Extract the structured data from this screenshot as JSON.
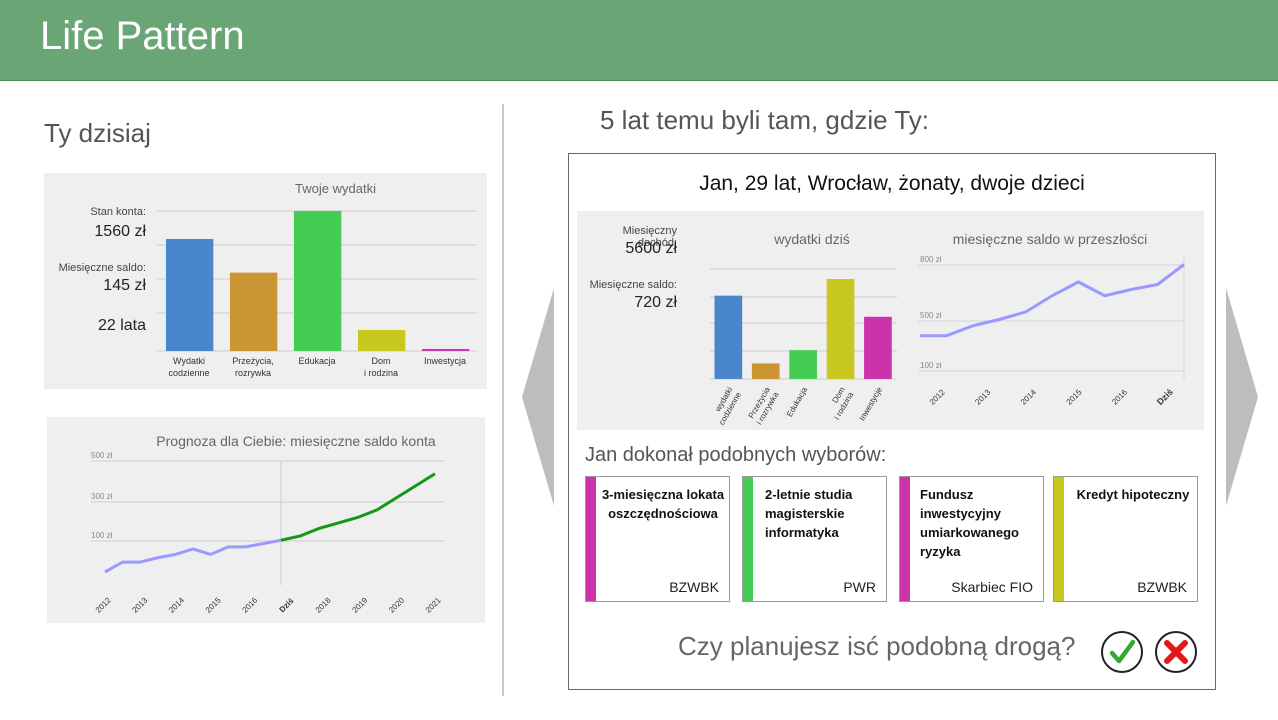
{
  "header": {
    "title": "Life Pattern"
  },
  "left": {
    "title": "Ty dzisiaj",
    "expenses_chart": {
      "title": "Twoje wydatki"
    },
    "stats": {
      "balance_label": "Stan konta:",
      "balance_value": "1560 zł",
      "saldo_label": "Miesięczne saldo:",
      "saldo_value": "145 zł",
      "age": "22 lata"
    },
    "forecast_chart": {
      "title": "Prognoza dla Ciebie: miesięczne saldo konta"
    }
  },
  "right": {
    "title": "5 lat temu byli tam, gdzie Ty:",
    "person": "Jan, 29 lat, Wrocław, żonaty, dwoje dzieci",
    "stats": {
      "income_label": "Miesięczny dochód:",
      "income_value": "5600 zł",
      "saldo_label": "Miesięczne saldo:",
      "saldo_value": "720 zł"
    },
    "expenses_chart": {
      "title": "wydatki dziś"
    },
    "saldo_chart": {
      "title": "miesięczne saldo w przeszłości"
    },
    "choices_title": "Jan dokonał podobnych wyborów:",
    "choices": [
      {
        "title": "3-miesięczna lokata oszczędnościowa",
        "org": "BZWBK",
        "color": "#cc33aa"
      },
      {
        "title": "2-letnie studia magisterskie informatyka",
        "org": "PWR",
        "color": "#44cc55"
      },
      {
        "title": "Fundusz inwestycyjny umiarkowanego ryzyka",
        "org": "Skarbiec FIO",
        "color": "#cc33aa"
      },
      {
        "title": "Kredyt hipoteczny",
        "org": "BZWBK",
        "color": "#c8c820"
      }
    ],
    "question": "Czy planujesz isć podobną drogą?",
    "icons": {
      "accept": "check-icon",
      "reject": "cross-icon"
    }
  },
  "colors": {
    "header": "#6aa675",
    "accept": "#33a833",
    "reject": "#e01818"
  },
  "chart_data": [
    {
      "type": "bar",
      "title": "Twoje wydatki",
      "categories": [
        "Wydatki\ncodzienne",
        "Przeżycia,\nrozrywka",
        "Edukacja",
        "Dom\ni rodzina",
        "Inwestycja"
      ],
      "values": [
        80,
        56,
        100,
        15,
        1
      ],
      "colors": [
        "#4a86cc",
        "#cc9533",
        "#44cc55",
        "#c8c820",
        "#cc33aa"
      ],
      "grid": true
    },
    {
      "type": "line",
      "title": "Prognoza dla Ciebie: miesięczne saldo konta",
      "x": [
        "2012",
        "2013",
        "2014",
        "2015",
        "2016",
        "Dziś",
        "2018",
        "2019",
        "2020",
        "2021"
      ],
      "y_ticks": [
        "500 zł",
        "300 zł",
        "100 zł"
      ],
      "ylim": [
        -50,
        500
      ],
      "series": [
        {
          "values": [
            10,
            55,
            55,
            75,
            90,
            115,
            90,
            125,
            125,
            140,
            155
          ]
        },
        {
          "values": [
            155,
            175,
            210,
            235,
            260,
            295,
            350,
            405,
            460
          ]
        }
      ],
      "colors": [
        "#9999ff",
        "#119911"
      ]
    },
    {
      "type": "bar",
      "title": "wydatki dziś",
      "categories": [
        "wydatki\ncodzienne",
        "Przeżycia\ni rozrywka",
        "Edukacja",
        "Dom\ni rodzina",
        "Inwestycje"
      ],
      "values": [
        75,
        14,
        26,
        90,
        56
      ],
      "colors": [
        "#4a86cc",
        "#cc9533",
        "#44cc55",
        "#c8c820",
        "#cc33aa"
      ],
      "grid": true
    },
    {
      "type": "line",
      "title": "miesięczne saldo w przeszłości",
      "x": [
        "2012",
        "2013",
        "2014",
        "2015",
        "2016",
        "Dziś"
      ],
      "y_ticks": [
        "800 zł",
        "500 zł",
        "100 zł"
      ],
      "ylim": [
        0,
        800
      ],
      "series": [
        {
          "values": [
            330,
            330,
            410,
            460,
            520,
            650,
            760,
            650,
            700,
            740,
            900
          ]
        }
      ],
      "colors": [
        "#9999ff"
      ]
    }
  ]
}
